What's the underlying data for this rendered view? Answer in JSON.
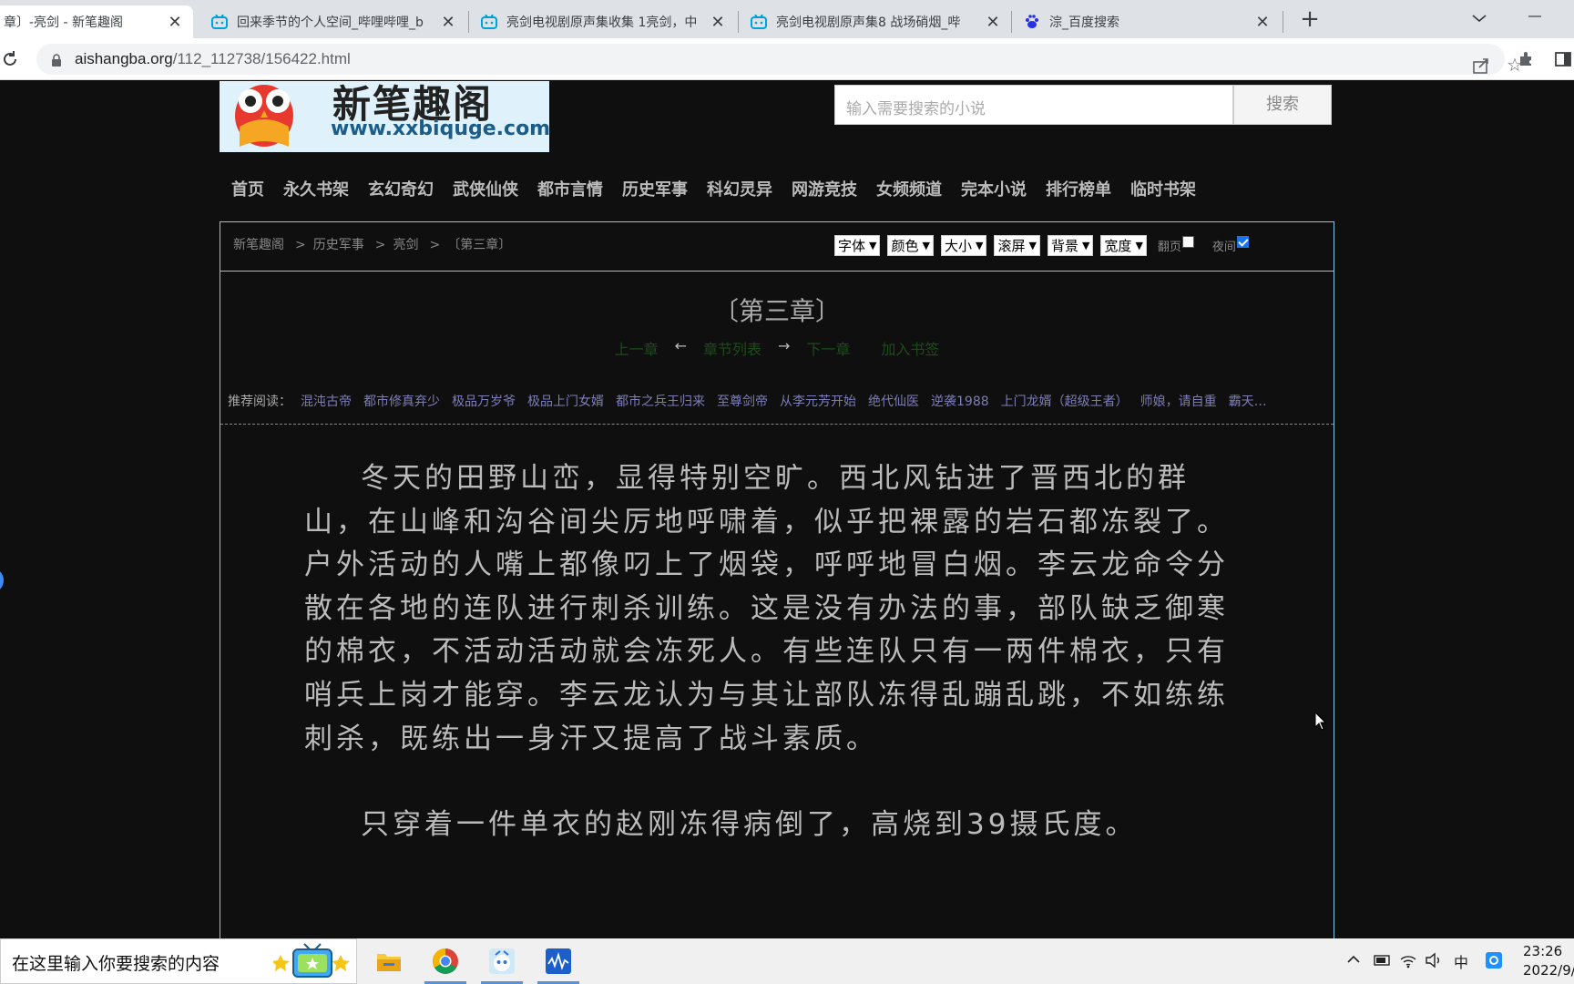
{
  "browser": {
    "tabs": [
      {
        "title": "章〕-亮剑 - 新笔趣阁",
        "active": true,
        "icon": "page-icon"
      },
      {
        "title": "回来季节的个人空间_哔哩哔哩_b",
        "active": false,
        "icon": "bilibili-icon"
      },
      {
        "title": "亮剑电视剧原声集收集 1亮剑，中",
        "active": false,
        "icon": "bilibili-icon"
      },
      {
        "title": "亮剑电视剧原声集8 战场硝烟_哔",
        "active": false,
        "icon": "bilibili-icon"
      },
      {
        "title": "淙_百度搜索",
        "active": false,
        "icon": "baidu-icon"
      }
    ],
    "new_tab": "+",
    "url_host": "aishangba.org",
    "url_path": "/112_112738/156422.html"
  },
  "site": {
    "logo_text": "新笔趣阁",
    "logo_url_text": "www.xxbiquge.com",
    "search_placeholder": "输入需要搜索的小说",
    "search_button": "搜索",
    "nav": [
      "首页",
      "永久书架",
      "玄幻奇幻",
      "武侠仙侠",
      "都市言情",
      "历史军事",
      "科幻灵异",
      "网游竞技",
      "女频频道",
      "完本小说",
      "排行榜单",
      "临时书架"
    ]
  },
  "breadcrumb": [
    "新笔趣阁",
    "历史军事",
    "亮剑",
    "〔第三章〕"
  ],
  "breadcrumb_sep": ">",
  "controls": {
    "selects": [
      "字体",
      "颜色",
      "大小",
      "滚屏",
      "背景",
      "宽度"
    ],
    "flip_label": "翻页",
    "flip_checked": false,
    "night_label": "夜间",
    "night_checked": true
  },
  "chapter": {
    "title": "〔第三章〕",
    "prev": "上一章",
    "arrow_left": "←",
    "list": "章节列表",
    "arrow_right": "→",
    "next": "下一章",
    "bookmark": "加入书签"
  },
  "recommend": {
    "label": "推荐阅读：",
    "items": [
      "混沌古帝",
      "都市修真弃少",
      "极品万岁爷",
      "极品上门女婿",
      "都市之兵王归来",
      "至尊剑帝",
      "从李元芳开始",
      "绝代仙医",
      "逆袭1988",
      "上门龙婿（超级王者）",
      "师娘，请自重",
      "霸天…"
    ]
  },
  "content": {
    "paragraphs": [
      "冬天的田野山峦，显得特别空旷。西北风钻进了晋西北的群山，在山峰和沟谷间尖厉地呼啸着，似乎把裸露的岩石都冻裂了。户外活动的人嘴上都像叼上了烟袋，呼呼地冒白烟。李云龙命令分散在各地的连队进行刺杀训练。这是没有办法的事，部队缺乏御寒的棉衣，不活动活动就会冻死人。有些连队只有一两件棉衣，只有哨兵上岗才能穿。李云龙认为与其让部队冻得乱蹦乱跳，不如练练刺杀，既练出一身汗又提高了战斗素质。",
      "只穿着一件单衣的赵刚冻得病倒了，高烧到39摄氏度。"
    ]
  },
  "taskbar": {
    "search_text": "在这里输入你要搜索的内容",
    "apps": [
      "file-explorer-icon",
      "chrome-icon",
      "bilibili-live-icon",
      "audio-app-icon"
    ],
    "tray_ime": "中",
    "time": "23:26",
    "date": "2022/9/"
  }
}
